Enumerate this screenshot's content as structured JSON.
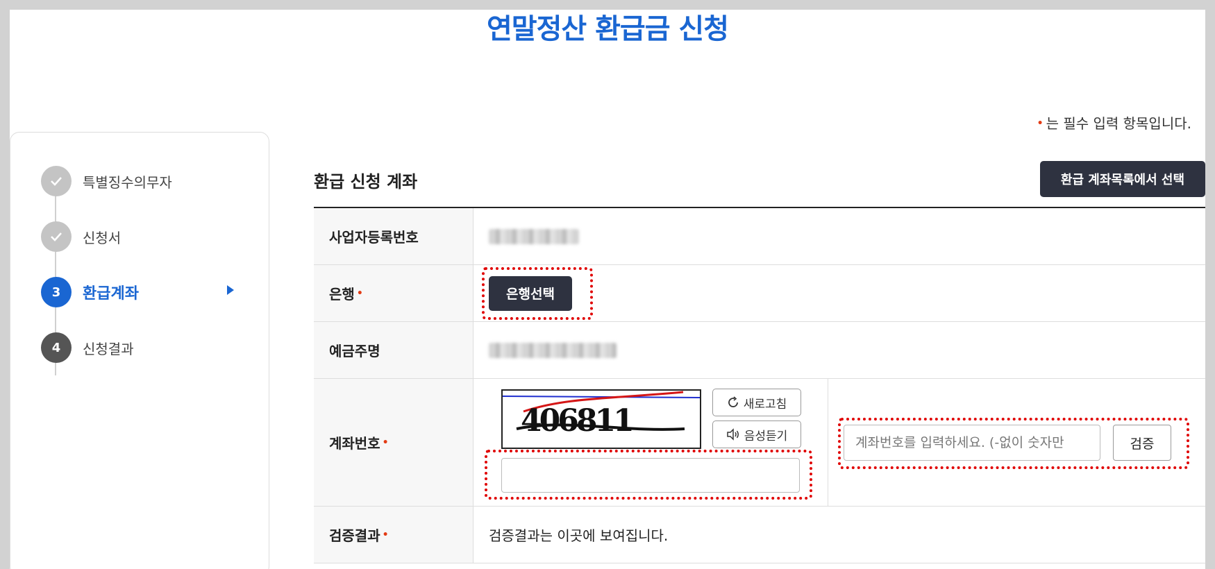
{
  "page": {
    "title": "연말정산 환급금 신청"
  },
  "required_note": {
    "marker": "•",
    "text": "는 필수 입력 항목입니다."
  },
  "stepper": {
    "steps": [
      {
        "label": "특별징수의무자",
        "state": "done",
        "marker": "check-icon"
      },
      {
        "label": "신청서",
        "state": "done",
        "marker": "check-icon"
      },
      {
        "label": "환급계좌",
        "state": "active",
        "number": "3"
      },
      {
        "label": "신청결과",
        "state": "todo",
        "number": "4"
      }
    ]
  },
  "section": {
    "title": "환급 신청 계좌",
    "select_account_label": "환급 계좌목록에서 선택"
  },
  "form": {
    "business_no": {
      "label": "사업자등록번호"
    },
    "bank": {
      "label": "은행",
      "button": "은행선택"
    },
    "depositor": {
      "label": "예금주명"
    },
    "account": {
      "label": "계좌번호",
      "refresh_label": "새로고침",
      "listen_label": "음성듣기",
      "captcha_text": "406811",
      "captcha_input_value": "",
      "input_placeholder": "계좌번호를 입력하세요. (-없이 숫자만",
      "verify_label": "검증"
    },
    "result": {
      "label": "검증결과",
      "text": "검증결과는 이곳에 보여집니다."
    }
  },
  "colors": {
    "accent": "#1a66d2",
    "dark_button": "#2e3240",
    "required": "#e33b14",
    "highlight": "#e00000"
  }
}
